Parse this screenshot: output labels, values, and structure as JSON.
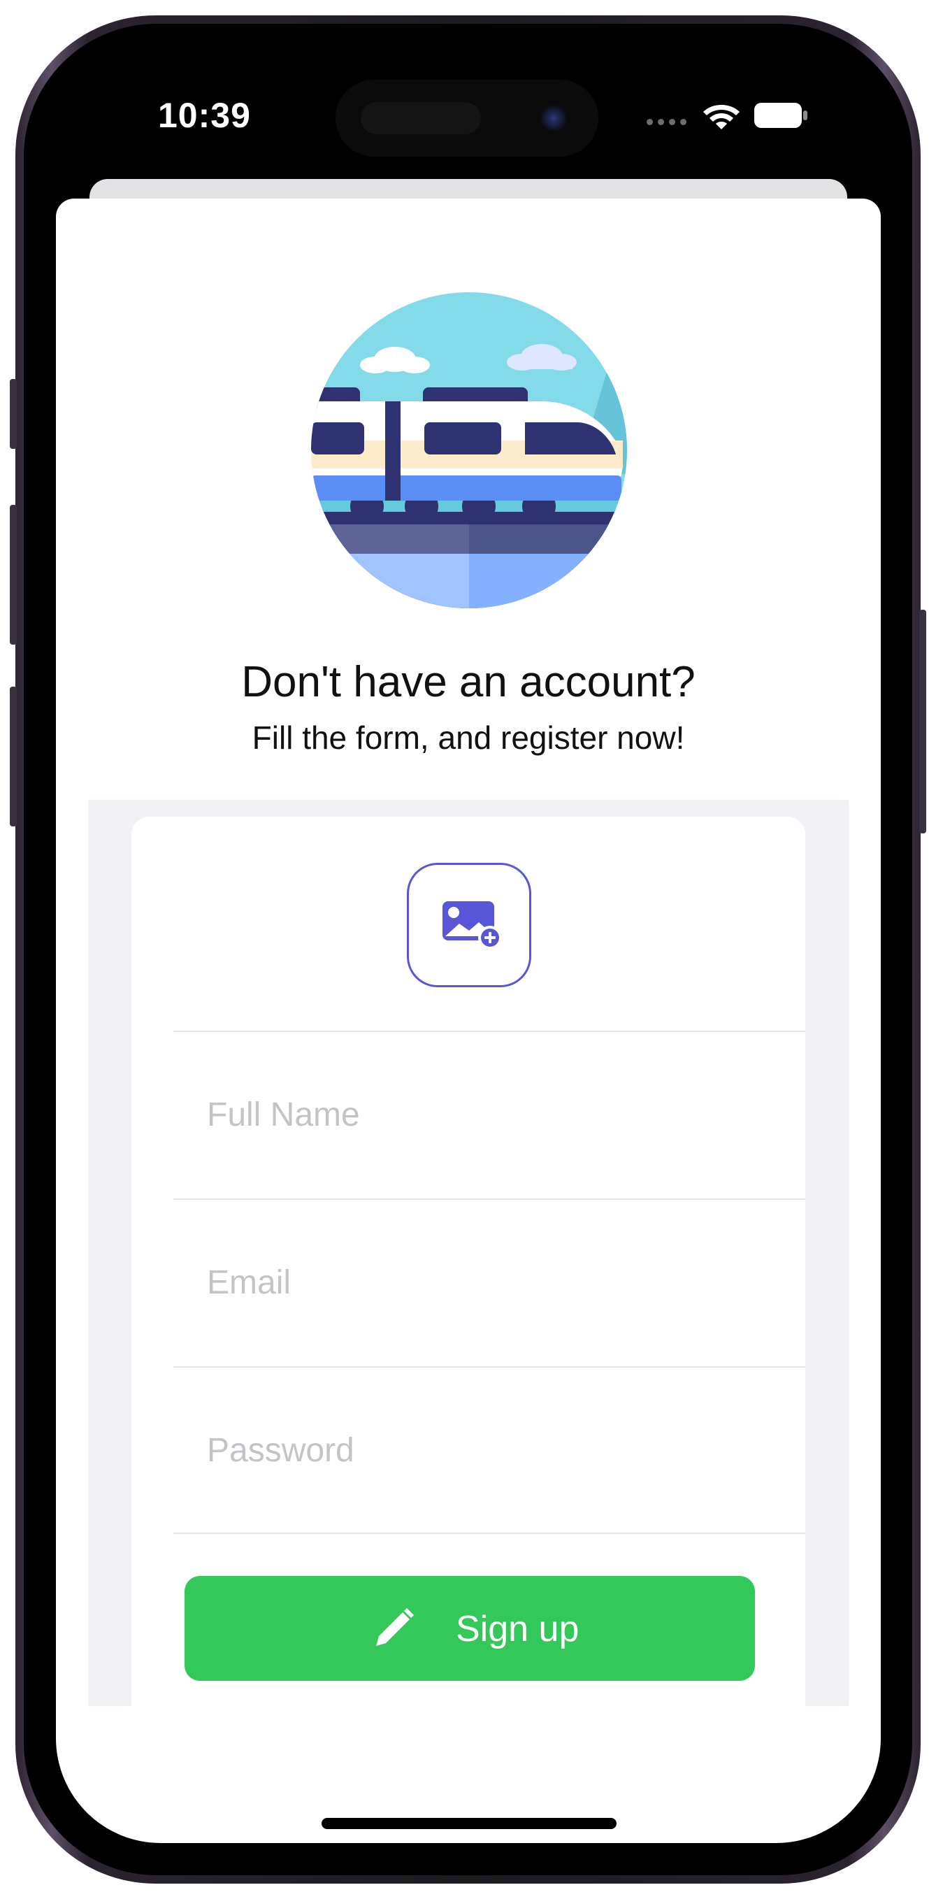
{
  "status_bar": {
    "time": "10:39",
    "wifi_icon": "wifi-icon",
    "battery_icon": "battery-icon"
  },
  "hero": {
    "image": "train-illustration"
  },
  "intro": {
    "headline": "Don't have an account?",
    "subhead": "Fill the form, and register now!"
  },
  "form": {
    "avatar_picker_icon": "add-photo-icon",
    "full_name": {
      "value": "",
      "placeholder": "Full Name"
    },
    "email": {
      "value": "",
      "placeholder": "Email"
    },
    "password": {
      "value": "",
      "placeholder": "Password"
    },
    "signup_button": {
      "label": "Sign up",
      "icon": "pencil-icon"
    }
  },
  "colors": {
    "accent_purple": "#5856d6",
    "signup_green": "#34c759",
    "form_background": "#f2f2f6",
    "placeholder_gray": "#c4c4c8"
  }
}
